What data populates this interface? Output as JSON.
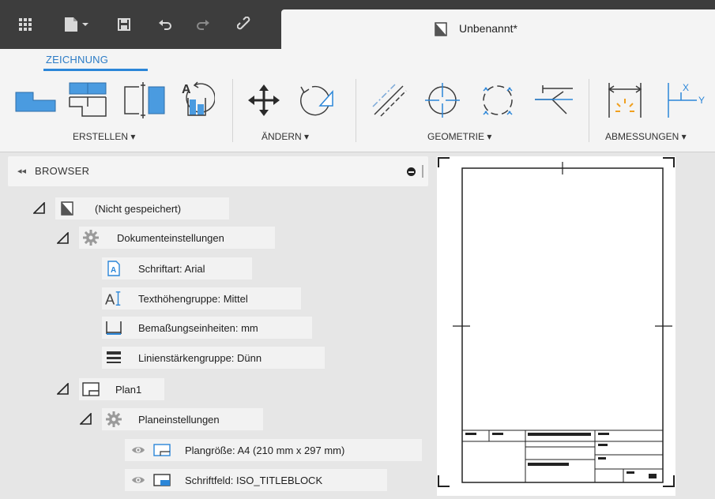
{
  "document": {
    "title": "Unbenannt*"
  },
  "toolbar": {
    "icons": [
      "apps-grid-icon",
      "file-icon",
      "save-icon",
      "undo-icon",
      "redo-icon",
      "link-icon"
    ]
  },
  "workspace": {
    "active_tab": "ZEICHNUNG"
  },
  "ribbon": {
    "groups": [
      {
        "label": "ERSTELLEN ▾",
        "tools": [
          "base-view-icon",
          "projected-view-icon",
          "section-view-icon",
          "detail-view-icon"
        ]
      },
      {
        "label": "ÄNDERN ▾",
        "tools": [
          "move-icon",
          "rotate-icon"
        ]
      },
      {
        "label": "GEOMETRIE ▾",
        "tools": [
          "centerline-icon",
          "center-mark-icon",
          "center-pattern-icon",
          "edge-extension-icon"
        ]
      },
      {
        "label": "ABMESSUNGEN ▾",
        "tools": [
          "dimension-icon",
          "ordinate-dimension-icon"
        ]
      }
    ]
  },
  "browser": {
    "title": "BROWSER",
    "collapse_glyph": "◂◂",
    "tree": {
      "root": "(Nicht gespeichert)",
      "document_settings": {
        "label": "Dokumenteinstellungen",
        "items": [
          "Schriftart: Arial",
          "Texthöhengruppe: Mittel",
          "Bemaßungseinheiten: mm",
          "Linienstärkengruppe: Dünn"
        ]
      },
      "sheet": {
        "label": "Plan1",
        "settings_label": "Planeinstellungen",
        "items": [
          "Plangröße: A4 (210 mm x 297 mm)",
          "Schriftfeld: ISO_TITLEBLOCK"
        ]
      }
    }
  },
  "colors": {
    "accent": "#2b86d8",
    "icon_blue": "#4a9be0",
    "topbar": "#3d3d3d"
  }
}
